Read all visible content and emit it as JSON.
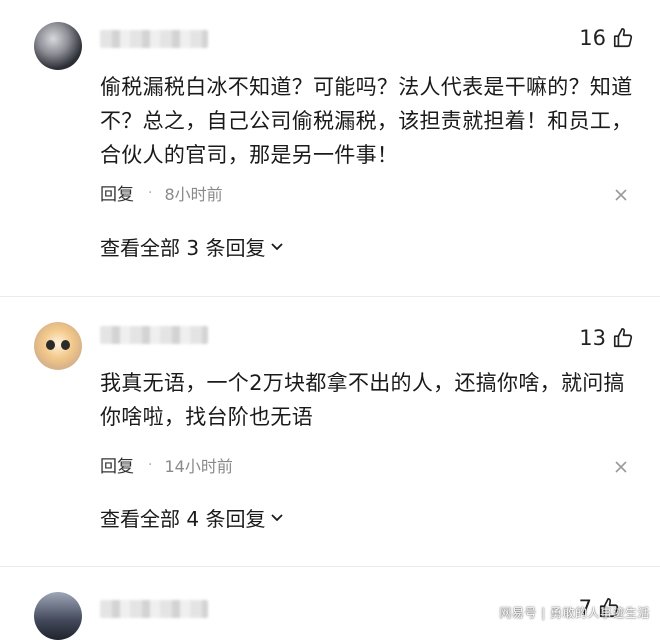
{
  "comments": [
    {
      "likes": "16",
      "text": "偷税漏税白冰不知道？可能吗？法人代表是干嘛的？知道不？总之，自己公司偷税漏税，该担责就担着！和员工，合伙人的官司，那是另一件事！",
      "reply_label": "回复",
      "separator": "·",
      "time": "8小时前",
      "view_replies": "查看全部 3 条回复"
    },
    {
      "likes": "13",
      "text": "我真无语，一个2万块都拿不出的人，还搞你啥，就问搞你啥啦，找台阶也无语",
      "reply_label": "回复",
      "separator": "·",
      "time": "14小时前",
      "view_replies": "查看全部 4 条回复"
    },
    {
      "likes": "7"
    }
  ],
  "watermark": "网易号 | 勇敢的人事迹生活",
  "icons": {
    "like": "thumbs-up-icon",
    "close": "close-icon",
    "expand": "chevron-down-icon"
  }
}
